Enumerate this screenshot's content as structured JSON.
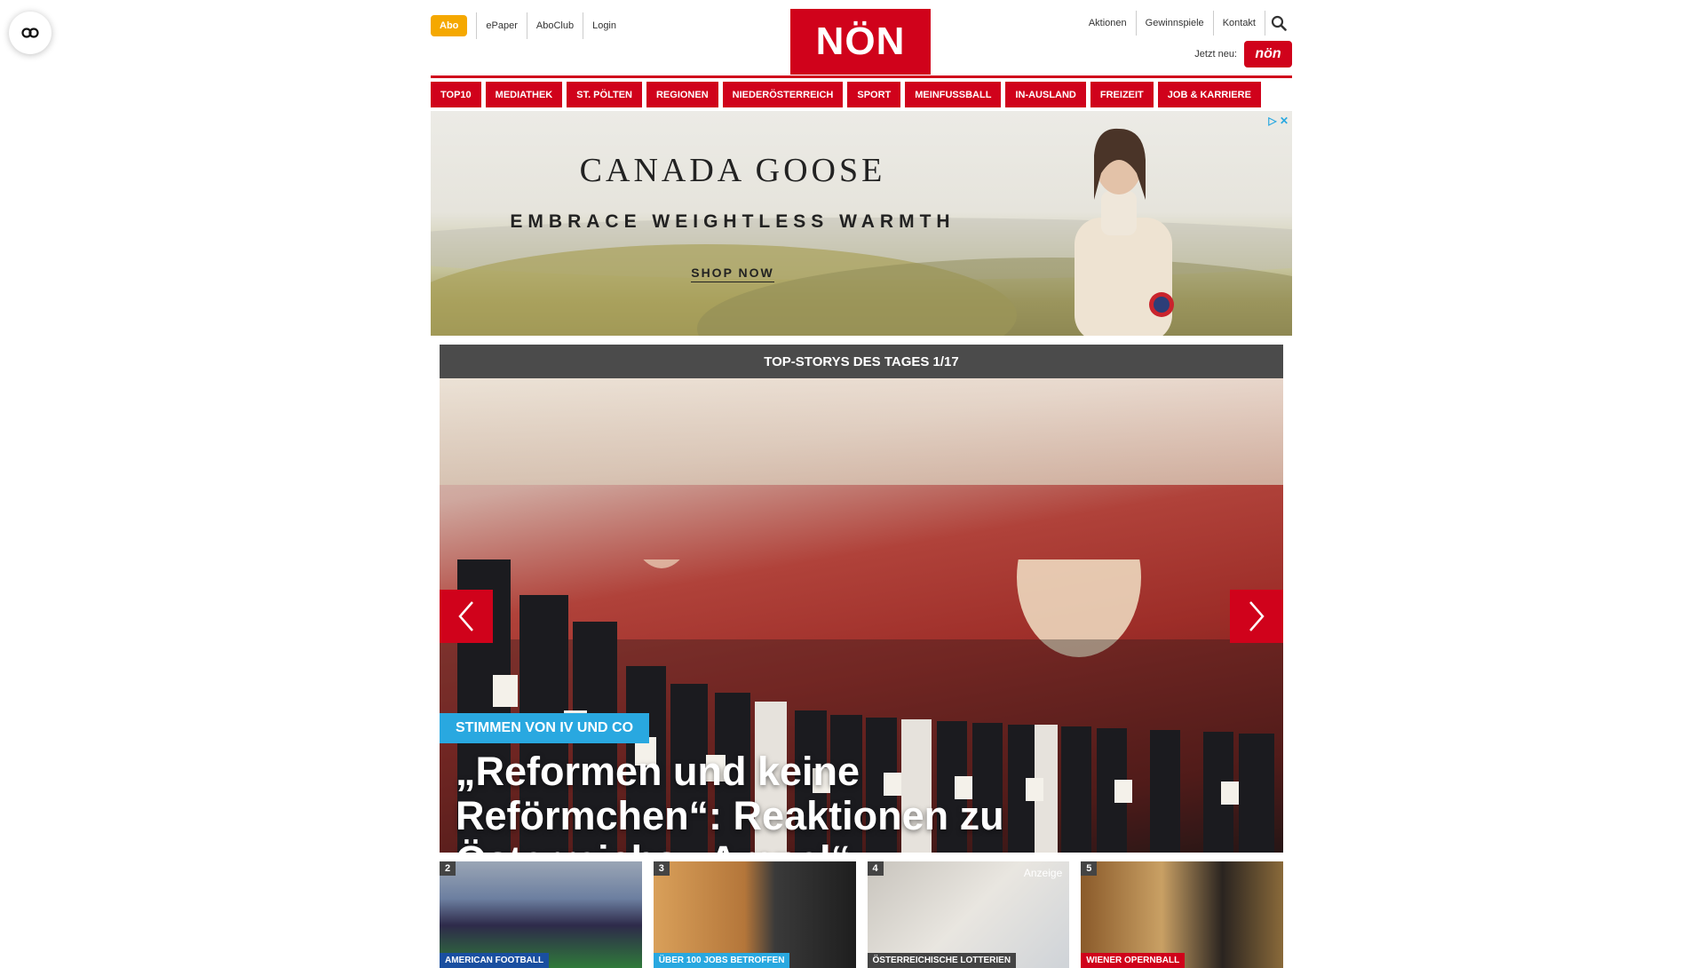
{
  "header": {
    "abo": "Abo",
    "left_links": [
      "ePaper",
      "AboClub",
      "Login"
    ],
    "logo": "NÖN",
    "right_links": [
      "Aktionen",
      "Gewinnspiele",
      "Kontakt"
    ],
    "jetzt_label": "Jetzt neu:",
    "mini_logo": "nön"
  },
  "nav": [
    "TOP10",
    "MEDIATHEK",
    "ST. PÖLTEN",
    "REGIONEN",
    "NIEDERÖSTERREICH",
    "SPORT",
    "MEINFUSSBALL",
    "IN-AUSLAND",
    "FREIZEIT",
    "JOB & KARRIERE"
  ],
  "ad": {
    "brand": "CANADA GOOSE",
    "tagline": "EMBRACE WEIGHTLESS WARMTH",
    "cta": "SHOP NOW"
  },
  "stories": {
    "heading": "TOP-STORYS DES TAGES 1/17",
    "hero_category": "STIMMEN VON IV UND CO",
    "hero_title": "„Reformen und keine Reförmchen“: Reaktionen zu Österreichs „Ampel“",
    "thumbs": [
      {
        "num": "2",
        "category": "AMERICAN FOOTBALL",
        "cat_color": "#1a4fa0",
        "ad": ""
      },
      {
        "num": "3",
        "category": "ÜBER 100 JOBS BETROFFEN",
        "cat_color": "#29a8e0",
        "ad": ""
      },
      {
        "num": "4",
        "category": "ÖSTERREICHISCHE LOTTERIEN",
        "cat_color": "#444444",
        "ad": "Anzeige"
      },
      {
        "num": "5",
        "category": "WIENER OPERNBALL",
        "cat_color": "#d0021b",
        "ad": ""
      }
    ]
  },
  "colors": {
    "brand_red": "#d0021b",
    "abo_orange": "#f5a800",
    "accent_blue": "#29a8e0"
  },
  "icons": [
    "accessibility-icon",
    "search-icon",
    "chevron-left-icon",
    "chevron-right-icon",
    "ad-choices-icon"
  ]
}
